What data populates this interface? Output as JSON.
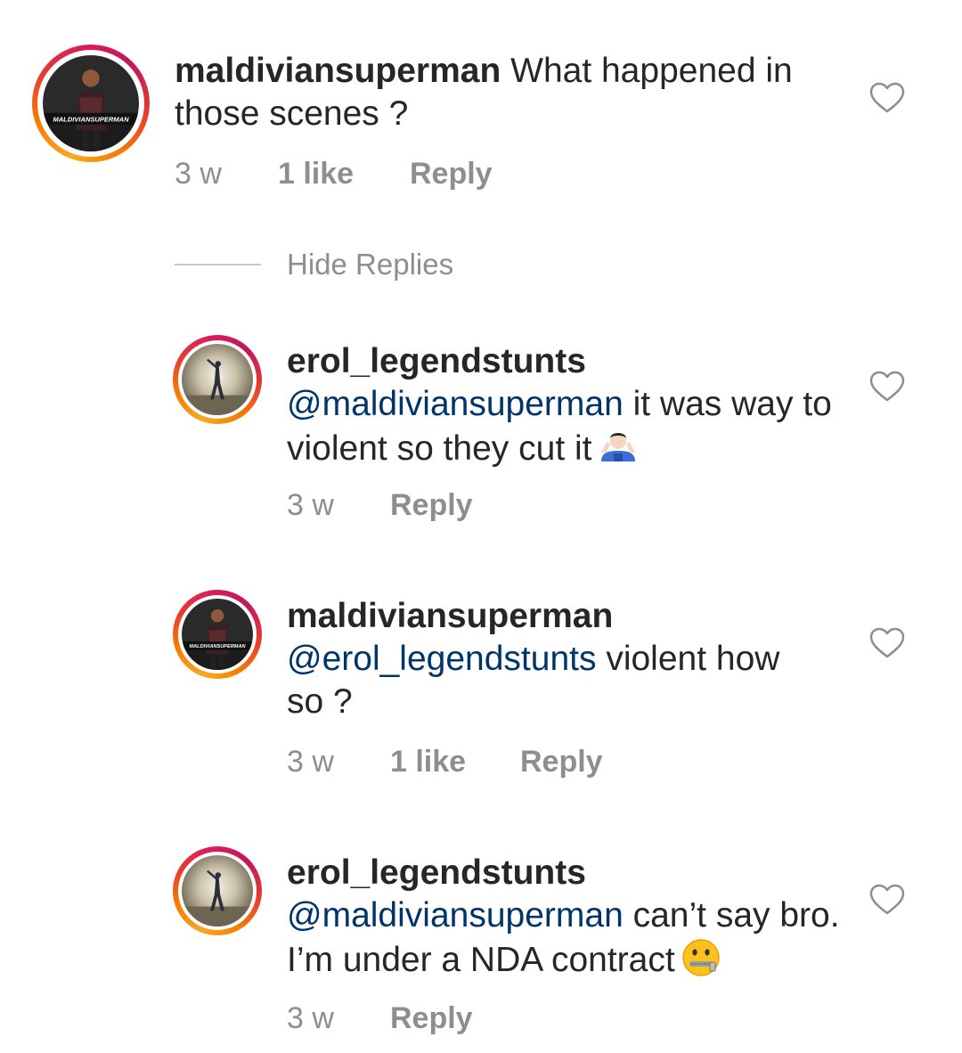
{
  "comments": [
    {
      "username": "maldiviansuperman",
      "mention": "",
      "text": " What happened in those scenes ?",
      "time": "3 w",
      "likes": "1 like",
      "reply_label": "Reply",
      "avatar_caption": "MALDIVIANSUPERMAN",
      "emoji": ""
    },
    {
      "username": "erol_legendstunts",
      "mention": "@maldiviansuperman",
      "text": " it was way to violent so they cut it",
      "time": "3 w",
      "likes": "",
      "reply_label": "Reply",
      "emoji": "person-shrugging-emoji"
    },
    {
      "username": "maldiviansuperman",
      "mention": "@erol_legendstunts",
      "text": " violent how so ?",
      "time": "3 w",
      "likes": "1 like",
      "reply_label": "Reply",
      "avatar_caption": "MALDIVIANSUPERMAN",
      "emoji": ""
    },
    {
      "username": "erol_legendstunts",
      "mention": "@maldiviansuperman",
      "text": " can’t say bro. I’m under a NDA contract",
      "time": "3 w",
      "likes": "",
      "reply_label": "Reply",
      "emoji": "zipper-mouth-face-emoji"
    }
  ],
  "hide_replies_label": "Hide Replies",
  "colors": {
    "text": "#262626",
    "secondary": "#8e8e8e",
    "mention": "#003569",
    "divider": "#c7c7c7"
  },
  "icons": {
    "like": "heart-outline-icon"
  }
}
